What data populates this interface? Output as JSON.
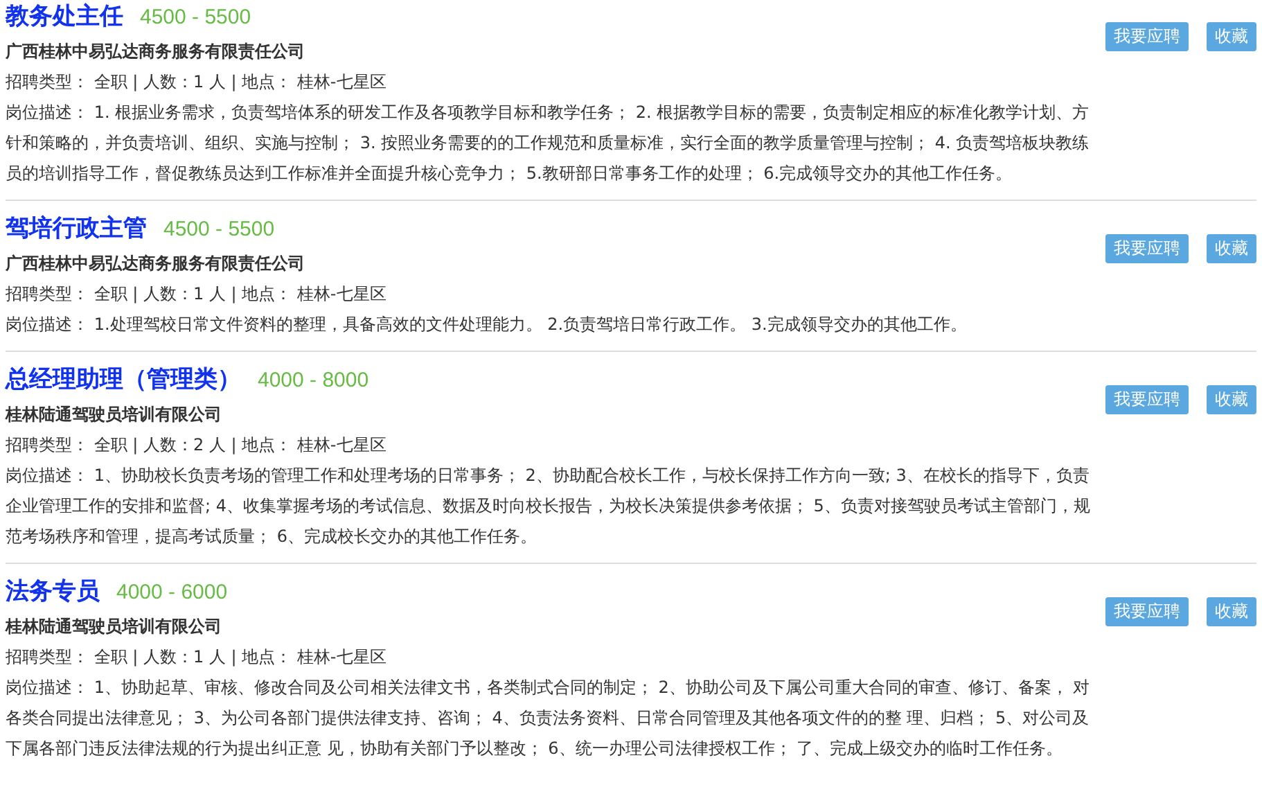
{
  "jobs": [
    {
      "title": "教务处主任",
      "salary": "4500 - 5500",
      "company": "广西桂林中易弘达商务服务有限责任公司",
      "meta": "招聘类型： 全职 | 人数：1 人 | 地点： 桂林-七星区",
      "description": "岗位描述： 1. 根据业务需求，负责驾培体系的研发工作及各项教学目标和教学任务； 2. 根据教学目标的需要，负责制定相应的标准化教学计划、方针和策略的，并负责培训、组织、实施与控制； 3. 按照业务需要的的工作规范和质量标准，实行全面的教学质量管理与控制； 4. 负责驾培板块教练员的培训指导工作，督促教练员达到工作标准并全面提升核心竞争力； 5.教研部日常事务工作的处理； 6.完成领导交办的其他工作任务。",
      "apply": "我要应聘",
      "save": "收藏"
    },
    {
      "title": "驾培行政主管",
      "salary": "4500 - 5500",
      "company": "广西桂林中易弘达商务服务有限责任公司",
      "meta": "招聘类型： 全职 | 人数：1 人 | 地点： 桂林-七星区",
      "description": "岗位描述： 1.处理驾校日常文件资料的整理，具备高效的文件处理能力。 2.负责驾培日常行政工作。 3.完成领导交办的其他工作。",
      "apply": "我要应聘",
      "save": "收藏"
    },
    {
      "title": "总经理助理（管理类）",
      "salary": "4000 - 8000",
      "company": "桂林陆通驾驶员培训有限公司",
      "meta": "招聘类型： 全职 | 人数：2 人 | 地点： 桂林-七星区",
      "description": "岗位描述： 1、协助校长负责考场的管理工作和处理考场的日常事务； 2、协助配合校长工作，与校长保持工作方向一致; 3、在校长的指导下，负责企业管理工作的安排和监督; 4、收集掌握考场的考试信息、数据及时向校长报告，为校长决策提供参考依据； 5、负责对接驾驶员考试主管部门，规范考场秩序和管理，提高考试质量； 6、完成校长交办的其他工作任务。",
      "apply": "我要应聘",
      "save": "收藏"
    },
    {
      "title": "法务专员",
      "salary": "4000 - 6000",
      "company": "桂林陆通驾驶员培训有限公司",
      "meta": "招聘类型： 全职 | 人数：1 人 | 地点： 桂林-七星区",
      "description": "岗位描述： 1、协助起草、审核、修改合同及公司相关法律文书，各类制式合同的制定； 2、协助公司及下属公司重大合同的审查、修订、备案， 对各类合同提出法律意见； 3、为公司各部门提供法律支持、咨询； 4、负责法务资料、日常合同管理及其他各项文件的的整 理、归档； 5、对公司及下属各部门违反法律法规的行为提出纠正意 见，协助有关部门予以整改； 6、统一办理公司法律授权工作； 了、完成上级交办的临时工作任务。",
      "apply": "我要应聘",
      "save": "收藏"
    }
  ]
}
